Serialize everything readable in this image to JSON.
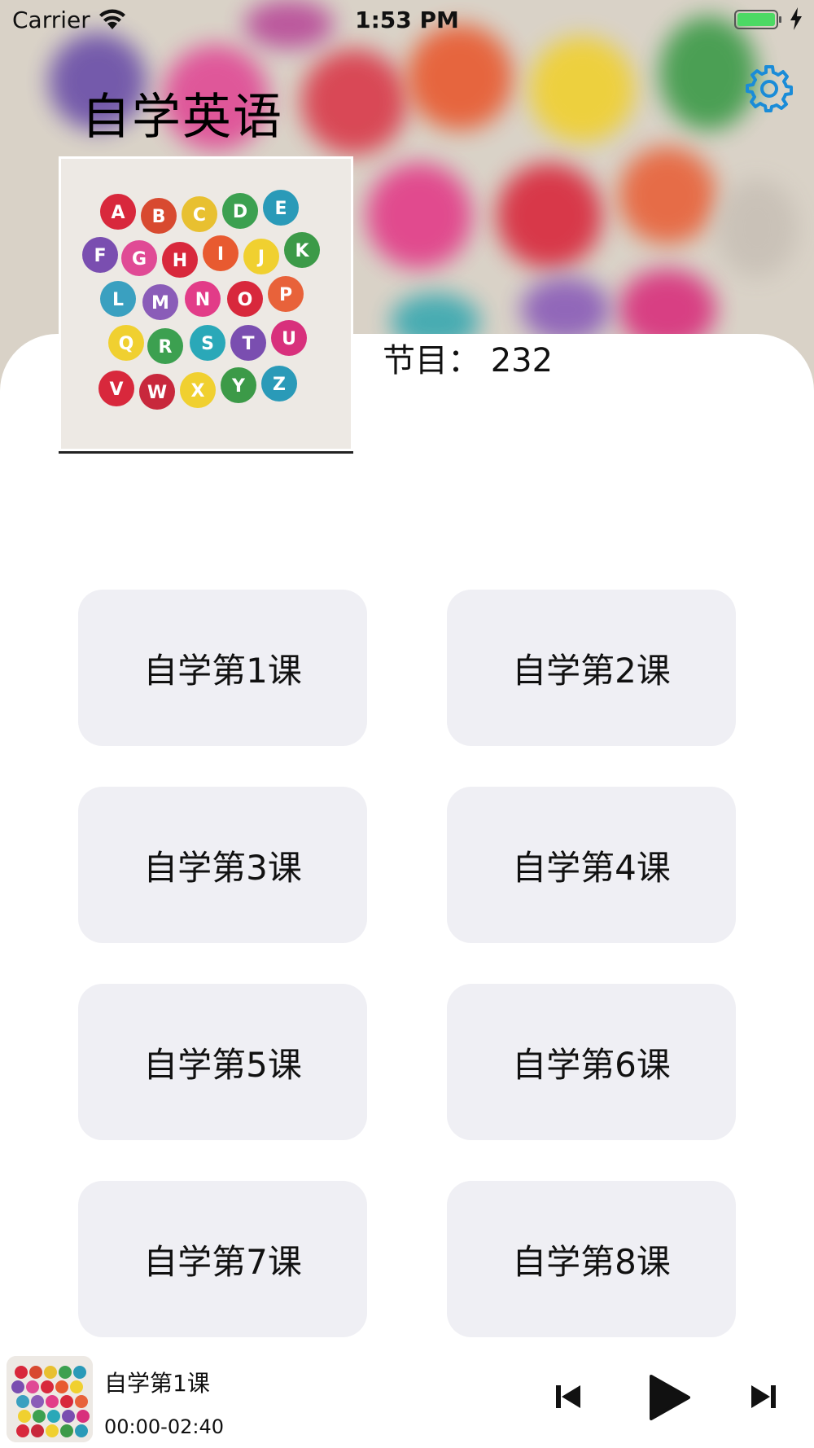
{
  "status_bar": {
    "carrier": "Carrier",
    "time": "1:53 PM"
  },
  "header": {
    "title": "自学英语",
    "settings_icon": "gear-icon"
  },
  "album": {
    "program_count": "节目： 232"
  },
  "lessons": [
    {
      "label": "自学第1课"
    },
    {
      "label": "自学第2课"
    },
    {
      "label": "自学第3课"
    },
    {
      "label": "自学第4课"
    },
    {
      "label": "自学第5课"
    },
    {
      "label": "自学第6课"
    },
    {
      "label": "自学第7课"
    },
    {
      "label": "自学第8课"
    }
  ],
  "player": {
    "title": "自学第1课",
    "time": "00:00-02:40",
    "controls": [
      "previous-icon",
      "play-icon",
      "next-icon"
    ]
  },
  "colors": {
    "accent": "#1a8cd8",
    "lesson_bg": "#efeff4",
    "battery": "#4cd964"
  }
}
